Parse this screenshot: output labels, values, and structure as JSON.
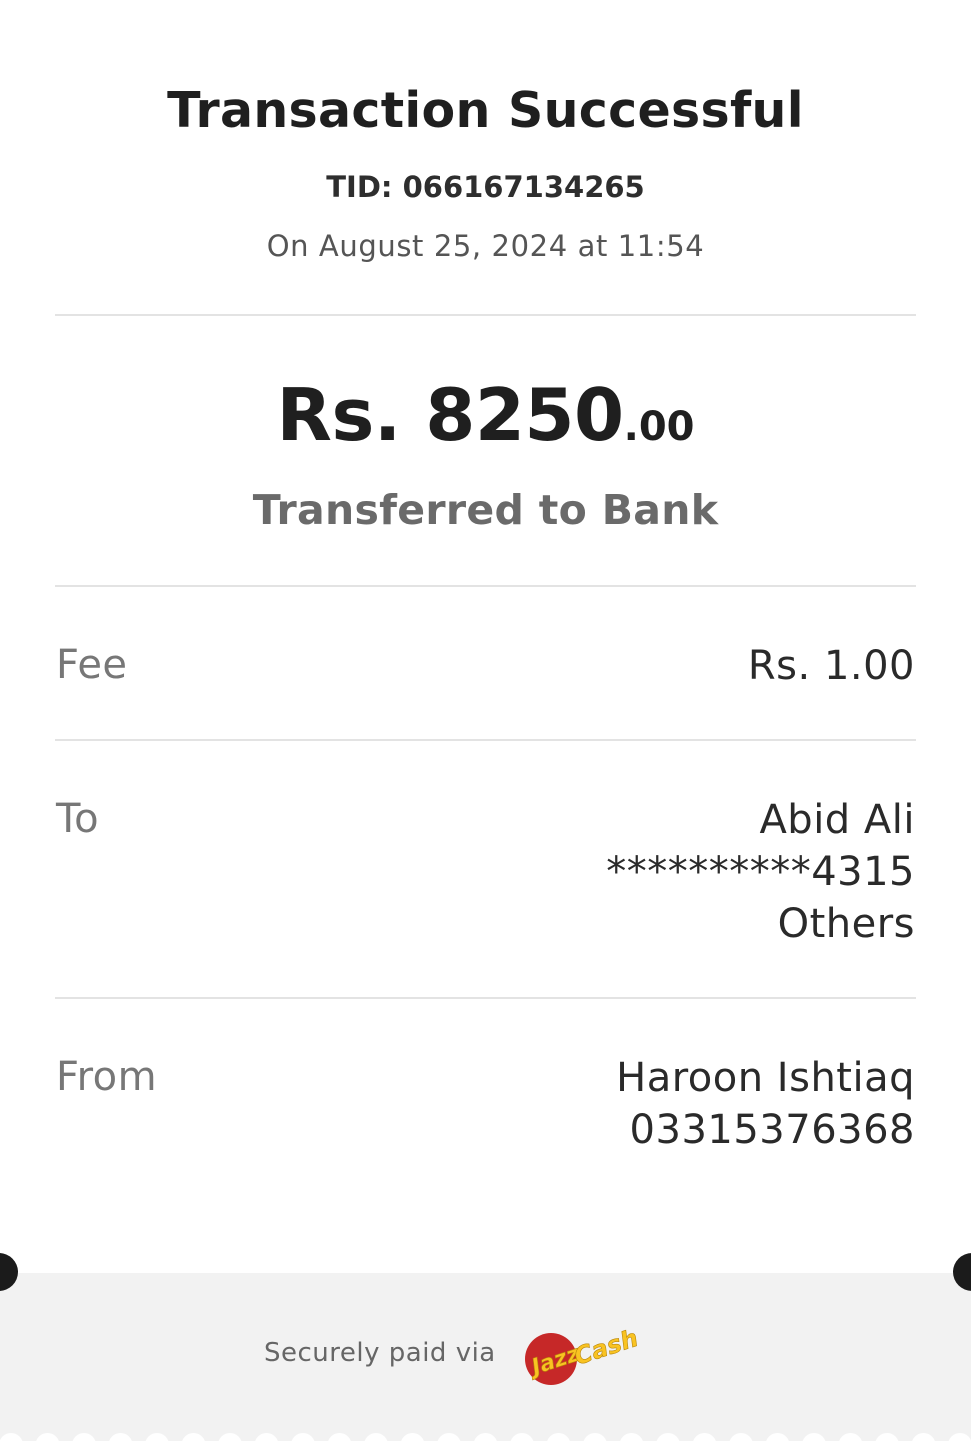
{
  "receipt": {
    "title": "Transaction Successful",
    "tid": "TID: 066167134265",
    "datetime": "On August 25, 2024 at 11:54",
    "amount_main": "Rs. 8250",
    "amount_cents": ".00",
    "amount_label": "Transferred to Bank",
    "fee": {
      "label": "Fee",
      "value": "Rs. 1.00"
    },
    "to": {
      "label": "To",
      "name": "Abid Ali",
      "account": "**********4315",
      "bank": "Others"
    },
    "from": {
      "label": "From",
      "name": "Haroon Ishtiaq",
      "number": "03315376368"
    }
  },
  "footer": {
    "secure_text": "Securely paid via",
    "logo_text_jazz": "Jazz",
    "logo_text_cash": "Cash",
    "logo_name": "jazzcash-logo",
    "colors": {
      "logo_red": "#c62828",
      "logo_yellow": "#f9c322",
      "background": "#f2f2f2"
    }
  }
}
